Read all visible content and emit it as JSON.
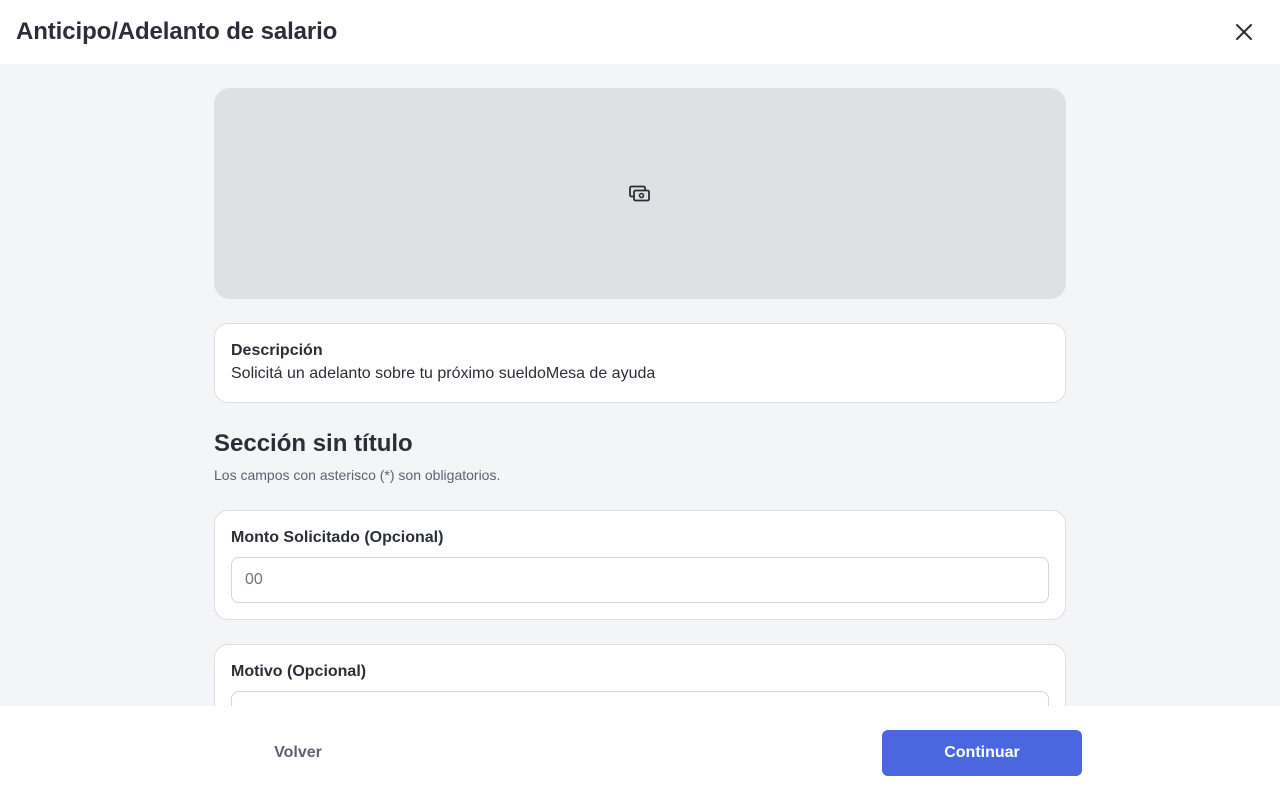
{
  "header": {
    "title": "Anticipo/Adelanto de salario",
    "close_icon": "close-icon"
  },
  "banner": {
    "icon": "money-icon"
  },
  "description": {
    "label": "Descripción",
    "text": "Solicitá un adelanto sobre tu próximo sueldoMesa de ayuda"
  },
  "section": {
    "title": "Sección sin título",
    "note": "Los campos con asterisco (*) son obligatorios."
  },
  "fields": [
    {
      "label": "Monto Solicitado (Opcional)",
      "placeholder": "00",
      "value": ""
    },
    {
      "label": "Motivo (Opcional)",
      "placeholder": "",
      "value": ""
    }
  ],
  "footer": {
    "back_label": "Volver",
    "continue_label": "Continuar",
    "accent_color": "#4a67e0"
  }
}
